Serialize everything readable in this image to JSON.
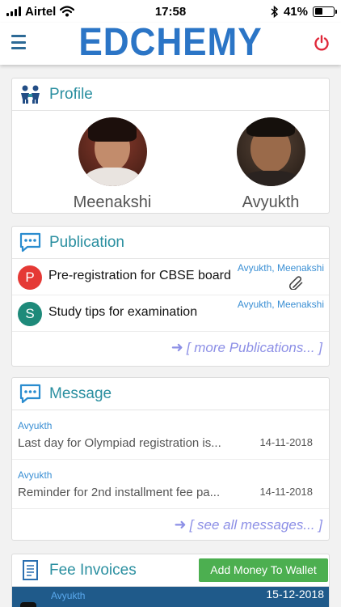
{
  "status_bar": {
    "carrier": "Airtel",
    "time": "17:58",
    "battery": "41%",
    "battery_level": 0.41
  },
  "header": {
    "logo": "EDCHEMY"
  },
  "profile": {
    "title": "Profile",
    "students": [
      {
        "name": "Meenakshi"
      },
      {
        "name": "Avyukth"
      }
    ]
  },
  "publication": {
    "title": "Publication",
    "items": [
      {
        "letter": "P",
        "color": "#e53935",
        "title": "Pre-registration for CBSE board",
        "audience": "Avyukth, Meenakshi",
        "has_attachment": true
      },
      {
        "letter": "S",
        "color": "#1e8a7a",
        "title": "Study tips for examination",
        "audience": "Avyukth, Meenakshi",
        "has_attachment": false
      }
    ],
    "more_label": "[ more Publications... ]"
  },
  "message": {
    "title": "Message",
    "items": [
      {
        "from": "Avyukth",
        "text": "Last day for Olympiad registration is...",
        "date": "14-11-2018"
      },
      {
        "from": "Avyukth",
        "text": "Reminder for 2nd installment fee pa...",
        "date": "14-11-2018"
      }
    ],
    "more_label": "[ see all messages... ]"
  },
  "fee": {
    "title": "Fee Invoices",
    "wallet_button": "Add Money To Wallet",
    "row": {
      "from": "Avyukth",
      "date": "15-12-2018"
    }
  },
  "colors": {
    "brand": "#2b75c6",
    "title_teal": "#2a8fa0",
    "link_blue": "#3a8fd4",
    "link_purple": "#8c8fe6",
    "wallet_green": "#4caf50",
    "power_red": "#e0283a"
  }
}
